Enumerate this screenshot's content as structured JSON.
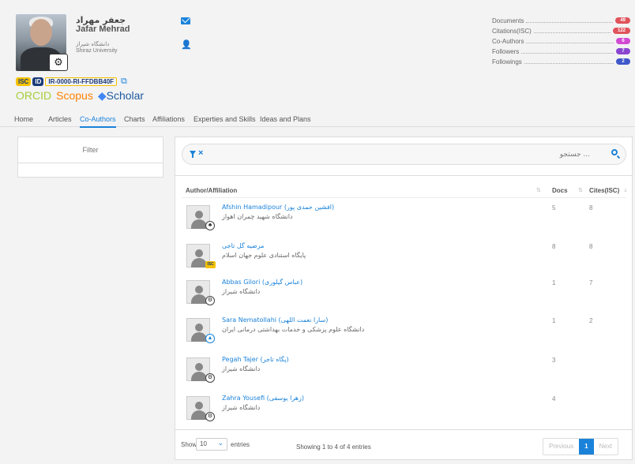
{
  "profile": {
    "name_fa": "جعفر مهراد",
    "name_en": "Jafar Mehrad",
    "affiliation_fa": "دانشگاه شیراز",
    "affiliation_en": "Shiraz University",
    "univ_badge_icon": "university-seal-icon",
    "isc_logo": "ISC",
    "isc_id_label": "ID",
    "isc_code": "IR-0000-RI-FFDBB40F",
    "orcid": "ORCID",
    "scopus": "Scopus",
    "scholar": "Scholar"
  },
  "stats": [
    {
      "label": "Documents",
      "value": "49",
      "color": "#e0535b"
    },
    {
      "label": "Citations(ISC)",
      "value": "122",
      "color": "#e0535b"
    },
    {
      "label": "Co-Authors",
      "value": "6",
      "color": "#d24ad4"
    },
    {
      "label": "Followers",
      "value": "7",
      "color": "#8a45d0"
    },
    {
      "label": "Followings",
      "value": "2",
      "color": "#3f57c9"
    }
  ],
  "tabs": [
    "Home",
    "Articles",
    "Co-Authors",
    "Charts",
    "Affiliations",
    "Experties and Skills",
    "Ideas and Plans"
  ],
  "filter": {
    "title": "Filter"
  },
  "search": {
    "placeholder": "... جستجو"
  },
  "table": {
    "headers": {
      "author": "Author/Affiliation",
      "docs": "Docs",
      "cites": "Cites(ISC)"
    },
    "rows": [
      {
        "name": "Afshin Hamadipour (افشین حمدی پور)",
        "affiliation": "دانشگاه شهید چمران اهواز",
        "docs": "5",
        "cites": "8",
        "badge": "chamran-icon"
      },
      {
        "name": "مرضیه گل تاجی",
        "affiliation": "پایگاه استنادی علوم جهان اسلام",
        "docs": "8",
        "cites": "8",
        "badge": "isc-icon"
      },
      {
        "name": "Abbas Gilori (عباس گیلوری)",
        "affiliation": "دانشگاه شیراز",
        "docs": "1",
        "cites": "7",
        "badge": "shiraz-icon"
      },
      {
        "name": "Sara Nematollahi (سارا نعمت اللهی)",
        "affiliation": "دانشگاه علوم پزشکی و خدمات بهداشتی درمانی ایران",
        "docs": "1",
        "cites": "2",
        "badge": "iums-icon"
      },
      {
        "name": "Pegah Tajer (پگاه تاجر)",
        "affiliation": "دانشگاه شیراز",
        "docs": "3",
        "cites": "",
        "badge": "shiraz-icon"
      },
      {
        "name": "Zahra Yousefi (زهرا یوسفی)",
        "affiliation": "دانشگاه شیراز",
        "docs": "4",
        "cites": "",
        "badge": "shiraz-icon"
      }
    ]
  },
  "footer": {
    "show": "Show",
    "entries_value": "10",
    "entries": "entries",
    "info": "Showing 1 to 4 of 4 entries",
    "previous": "Previous",
    "page": "1",
    "next": "Next"
  }
}
